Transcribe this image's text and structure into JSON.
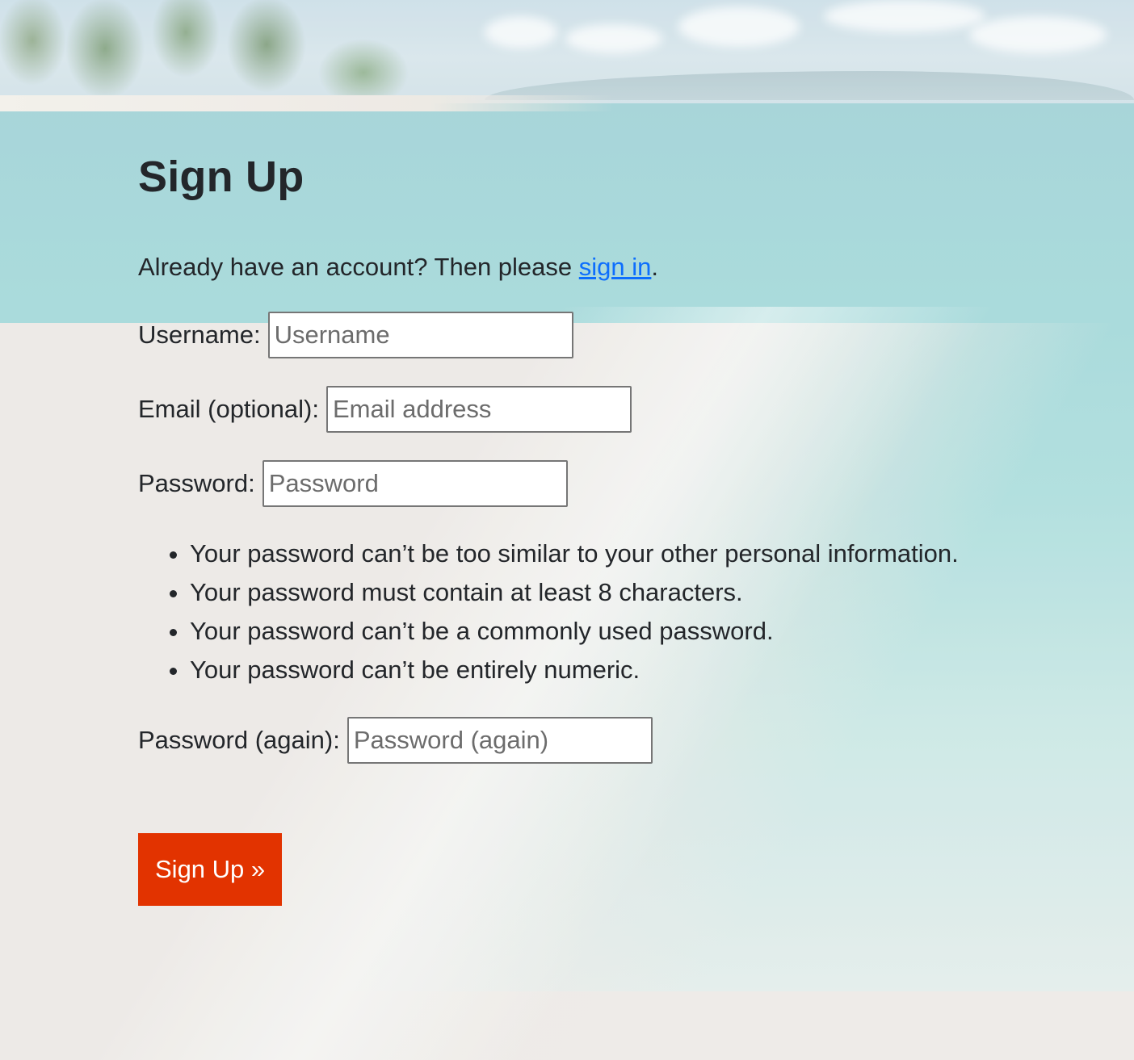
{
  "page": {
    "title": "Sign Up",
    "intro_text": "Already have an account? Then please ",
    "intro_link": "sign in",
    "intro_end": "."
  },
  "form": {
    "username": {
      "label": "Username:",
      "placeholder": "Username",
      "value": ""
    },
    "email": {
      "label": "Email (optional):",
      "placeholder": "Email address",
      "value": ""
    },
    "password": {
      "label": "Password:",
      "placeholder": "Password",
      "value": ""
    },
    "password_help": [
      "Your password can’t be too similar to your other personal information.",
      "Your password must contain at least 8 characters.",
      "Your password can’t be a commonly used password.",
      "Your password can’t be entirely numeric."
    ],
    "password_again": {
      "label": "Password (again):",
      "placeholder": "Password (again)",
      "value": ""
    },
    "submit_label": "Sign Up »"
  },
  "colors": {
    "primary_button": "#e23300",
    "link": "#0d6efd",
    "text": "#23262a"
  }
}
